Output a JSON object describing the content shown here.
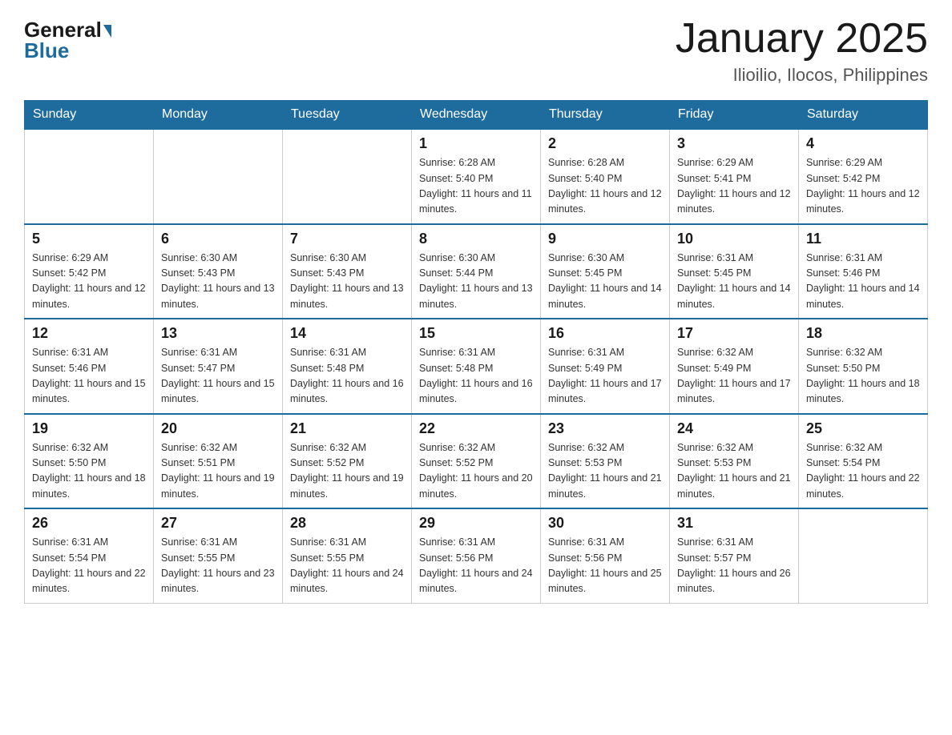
{
  "header": {
    "logo_general": "General",
    "logo_blue": "Blue",
    "month_title": "January 2025",
    "location": "Ilioilio, Ilocos, Philippines"
  },
  "days_of_week": [
    "Sunday",
    "Monday",
    "Tuesday",
    "Wednesday",
    "Thursday",
    "Friday",
    "Saturday"
  ],
  "weeks": [
    [
      {
        "day": "",
        "sunrise": "",
        "sunset": "",
        "daylight": ""
      },
      {
        "day": "",
        "sunrise": "",
        "sunset": "",
        "daylight": ""
      },
      {
        "day": "",
        "sunrise": "",
        "sunset": "",
        "daylight": ""
      },
      {
        "day": "1",
        "sunrise": "Sunrise: 6:28 AM",
        "sunset": "Sunset: 5:40 PM",
        "daylight": "Daylight: 11 hours and 11 minutes."
      },
      {
        "day": "2",
        "sunrise": "Sunrise: 6:28 AM",
        "sunset": "Sunset: 5:40 PM",
        "daylight": "Daylight: 11 hours and 12 minutes."
      },
      {
        "day": "3",
        "sunrise": "Sunrise: 6:29 AM",
        "sunset": "Sunset: 5:41 PM",
        "daylight": "Daylight: 11 hours and 12 minutes."
      },
      {
        "day": "4",
        "sunrise": "Sunrise: 6:29 AM",
        "sunset": "Sunset: 5:42 PM",
        "daylight": "Daylight: 11 hours and 12 minutes."
      }
    ],
    [
      {
        "day": "5",
        "sunrise": "Sunrise: 6:29 AM",
        "sunset": "Sunset: 5:42 PM",
        "daylight": "Daylight: 11 hours and 12 minutes."
      },
      {
        "day": "6",
        "sunrise": "Sunrise: 6:30 AM",
        "sunset": "Sunset: 5:43 PM",
        "daylight": "Daylight: 11 hours and 13 minutes."
      },
      {
        "day": "7",
        "sunrise": "Sunrise: 6:30 AM",
        "sunset": "Sunset: 5:43 PM",
        "daylight": "Daylight: 11 hours and 13 minutes."
      },
      {
        "day": "8",
        "sunrise": "Sunrise: 6:30 AM",
        "sunset": "Sunset: 5:44 PM",
        "daylight": "Daylight: 11 hours and 13 minutes."
      },
      {
        "day": "9",
        "sunrise": "Sunrise: 6:30 AM",
        "sunset": "Sunset: 5:45 PM",
        "daylight": "Daylight: 11 hours and 14 minutes."
      },
      {
        "day": "10",
        "sunrise": "Sunrise: 6:31 AM",
        "sunset": "Sunset: 5:45 PM",
        "daylight": "Daylight: 11 hours and 14 minutes."
      },
      {
        "day": "11",
        "sunrise": "Sunrise: 6:31 AM",
        "sunset": "Sunset: 5:46 PM",
        "daylight": "Daylight: 11 hours and 14 minutes."
      }
    ],
    [
      {
        "day": "12",
        "sunrise": "Sunrise: 6:31 AM",
        "sunset": "Sunset: 5:46 PM",
        "daylight": "Daylight: 11 hours and 15 minutes."
      },
      {
        "day": "13",
        "sunrise": "Sunrise: 6:31 AM",
        "sunset": "Sunset: 5:47 PM",
        "daylight": "Daylight: 11 hours and 15 minutes."
      },
      {
        "day": "14",
        "sunrise": "Sunrise: 6:31 AM",
        "sunset": "Sunset: 5:48 PM",
        "daylight": "Daylight: 11 hours and 16 minutes."
      },
      {
        "day": "15",
        "sunrise": "Sunrise: 6:31 AM",
        "sunset": "Sunset: 5:48 PM",
        "daylight": "Daylight: 11 hours and 16 minutes."
      },
      {
        "day": "16",
        "sunrise": "Sunrise: 6:31 AM",
        "sunset": "Sunset: 5:49 PM",
        "daylight": "Daylight: 11 hours and 17 minutes."
      },
      {
        "day": "17",
        "sunrise": "Sunrise: 6:32 AM",
        "sunset": "Sunset: 5:49 PM",
        "daylight": "Daylight: 11 hours and 17 minutes."
      },
      {
        "day": "18",
        "sunrise": "Sunrise: 6:32 AM",
        "sunset": "Sunset: 5:50 PM",
        "daylight": "Daylight: 11 hours and 18 minutes."
      }
    ],
    [
      {
        "day": "19",
        "sunrise": "Sunrise: 6:32 AM",
        "sunset": "Sunset: 5:50 PM",
        "daylight": "Daylight: 11 hours and 18 minutes."
      },
      {
        "day": "20",
        "sunrise": "Sunrise: 6:32 AM",
        "sunset": "Sunset: 5:51 PM",
        "daylight": "Daylight: 11 hours and 19 minutes."
      },
      {
        "day": "21",
        "sunrise": "Sunrise: 6:32 AM",
        "sunset": "Sunset: 5:52 PM",
        "daylight": "Daylight: 11 hours and 19 minutes."
      },
      {
        "day": "22",
        "sunrise": "Sunrise: 6:32 AM",
        "sunset": "Sunset: 5:52 PM",
        "daylight": "Daylight: 11 hours and 20 minutes."
      },
      {
        "day": "23",
        "sunrise": "Sunrise: 6:32 AM",
        "sunset": "Sunset: 5:53 PM",
        "daylight": "Daylight: 11 hours and 21 minutes."
      },
      {
        "day": "24",
        "sunrise": "Sunrise: 6:32 AM",
        "sunset": "Sunset: 5:53 PM",
        "daylight": "Daylight: 11 hours and 21 minutes."
      },
      {
        "day": "25",
        "sunrise": "Sunrise: 6:32 AM",
        "sunset": "Sunset: 5:54 PM",
        "daylight": "Daylight: 11 hours and 22 minutes."
      }
    ],
    [
      {
        "day": "26",
        "sunrise": "Sunrise: 6:31 AM",
        "sunset": "Sunset: 5:54 PM",
        "daylight": "Daylight: 11 hours and 22 minutes."
      },
      {
        "day": "27",
        "sunrise": "Sunrise: 6:31 AM",
        "sunset": "Sunset: 5:55 PM",
        "daylight": "Daylight: 11 hours and 23 minutes."
      },
      {
        "day": "28",
        "sunrise": "Sunrise: 6:31 AM",
        "sunset": "Sunset: 5:55 PM",
        "daylight": "Daylight: 11 hours and 24 minutes."
      },
      {
        "day": "29",
        "sunrise": "Sunrise: 6:31 AM",
        "sunset": "Sunset: 5:56 PM",
        "daylight": "Daylight: 11 hours and 24 minutes."
      },
      {
        "day": "30",
        "sunrise": "Sunrise: 6:31 AM",
        "sunset": "Sunset: 5:56 PM",
        "daylight": "Daylight: 11 hours and 25 minutes."
      },
      {
        "day": "31",
        "sunrise": "Sunrise: 6:31 AM",
        "sunset": "Sunset: 5:57 PM",
        "daylight": "Daylight: 11 hours and 26 minutes."
      },
      {
        "day": "",
        "sunrise": "",
        "sunset": "",
        "daylight": ""
      }
    ]
  ]
}
